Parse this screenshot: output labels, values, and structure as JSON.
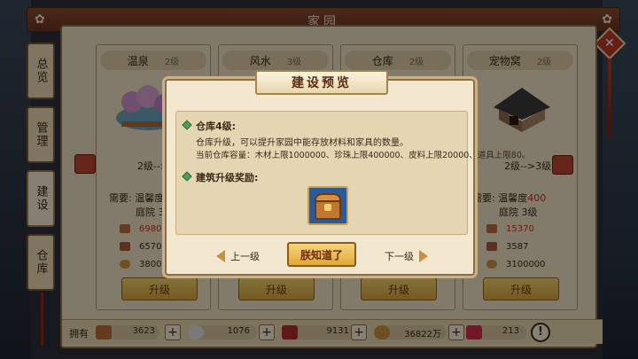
{
  "window": {
    "title": "家园"
  },
  "side_tabs": [
    {
      "label": "总览",
      "active": false
    },
    {
      "label": "管理",
      "active": false
    },
    {
      "label": "建设",
      "active": true
    },
    {
      "label": "仓库",
      "active": false
    }
  ],
  "cards": [
    {
      "name": "温泉",
      "level": "2级",
      "level_change": "2级-->3",
      "req_label": "需要: 温馨度",
      "req_val": "",
      "yard": "庭院 3",
      "res": [
        "6980",
        "6570",
        "380000"
      ]
    },
    {
      "name": "风水",
      "level": "3级"
    },
    {
      "name": "仓库",
      "level": "2级"
    },
    {
      "name": "宠物窝",
      "level": "2级",
      "level_change": "2级-->3级",
      "req_label": "需要: 温馨度",
      "req_val": "400",
      "yard": "庭院 3级",
      "res": [
        "15370",
        "3587",
        "3100000"
      ]
    }
  ],
  "upgrade_label": "升级",
  "bottom_bar": {
    "label": "拥有",
    "items": [
      {
        "icon": "wood-icon",
        "value": "3623"
      },
      {
        "icon": "pearl-icon",
        "value": "1076"
      },
      {
        "icon": "leather-icon",
        "value": "9131"
      },
      {
        "icon": "coin-icon",
        "value": "36822万"
      },
      {
        "icon": "gift-icon",
        "value": "213"
      }
    ],
    "info": "!"
  },
  "modal": {
    "title": "建设预览",
    "heading": "仓库4级:",
    "desc": "仓库升级，可以提升家园中能存放材料和家具的数量。",
    "capacity": "当前仓库容量：木材上限1000000、珍珠上限400000、皮料上限20000、道具上限80。",
    "reward_heading": "建筑升级奖励:",
    "prev": "上一级",
    "next": "下一级",
    "ok": "朕知道了"
  },
  "colors": {
    "accent": "#b84430",
    "button": "#e0a83a",
    "panel": "#f3e8cf"
  }
}
